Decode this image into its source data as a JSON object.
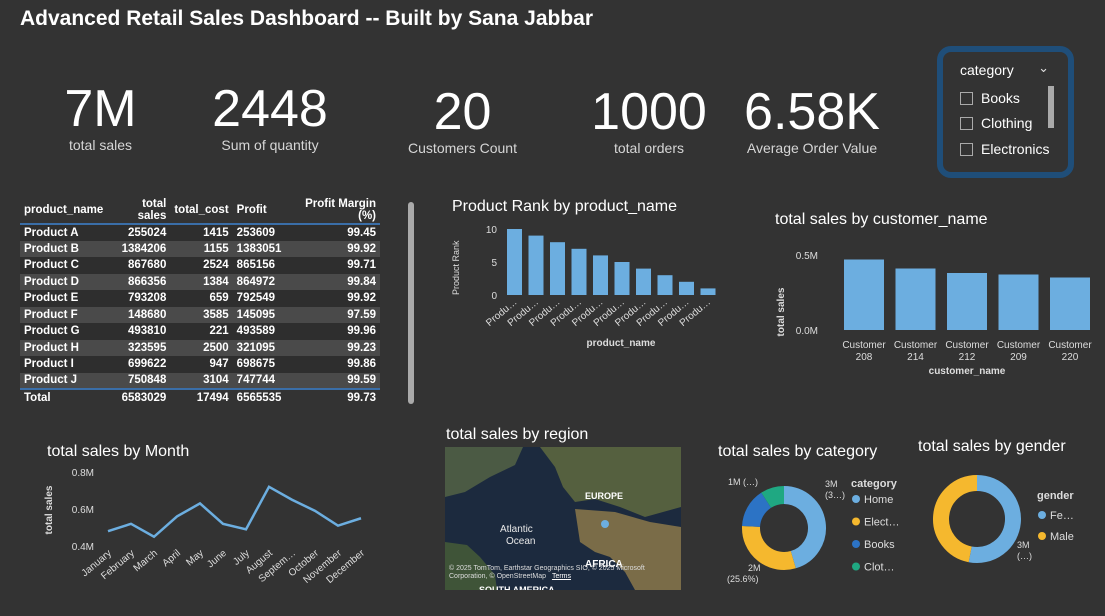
{
  "title": "Advanced Retail Sales Dashboard -- Built by Sana Jabbar",
  "kpis": [
    {
      "value": "7M",
      "label": "total sales"
    },
    {
      "value": "2448",
      "label": "Sum of quantity"
    },
    {
      "value": "20",
      "label": "Customers Count"
    },
    {
      "value": "1000",
      "label": "total orders"
    },
    {
      "value": "6.58K",
      "label": "Average Order Value"
    }
  ],
  "slicer": {
    "header": "category",
    "options": [
      "Books",
      "Clothing",
      "Electronics"
    ]
  },
  "table": {
    "columns": [
      "product_name",
      "total sales",
      "total_cost",
      "Profit",
      "Profit Margin (%)"
    ],
    "rows": [
      [
        "Product A",
        "255024",
        "1415",
        "253609",
        "99.45"
      ],
      [
        "Product B",
        "1384206",
        "1155",
        "1383051",
        "99.92"
      ],
      [
        "Product C",
        "867680",
        "2524",
        "865156",
        "99.71"
      ],
      [
        "Product D",
        "866356",
        "1384",
        "864972",
        "99.84"
      ],
      [
        "Product E",
        "793208",
        "659",
        "792549",
        "99.92"
      ],
      [
        "Product F",
        "148680",
        "3585",
        "145095",
        "97.59"
      ],
      [
        "Product G",
        "493810",
        "221",
        "493589",
        "99.96"
      ],
      [
        "Product H",
        "323595",
        "2500",
        "321095",
        "99.23"
      ],
      [
        "Product I",
        "699622",
        "947",
        "698675",
        "99.86"
      ],
      [
        "Product J",
        "750848",
        "3104",
        "747744",
        "99.59"
      ]
    ],
    "total": [
      "Total",
      "6583029",
      "17494",
      "6565535",
      "99.73"
    ]
  },
  "chart_data": [
    {
      "type": "bar",
      "title": "Product Rank by product_name",
      "xlabel": "product_name",
      "ylabel": "Product Rank",
      "categories": [
        "Produ…",
        "Produ…",
        "Produ…",
        "Produ…",
        "Produ…",
        "Produ…",
        "Produ…",
        "Produ…",
        "Produ…",
        "Produ…"
      ],
      "values": [
        10,
        9,
        8,
        7,
        6,
        5,
        4,
        3,
        2,
        1
      ],
      "yticks": [
        "0",
        "5",
        "10"
      ],
      "ylim": [
        0,
        10
      ],
      "color": "#6caee0"
    },
    {
      "type": "bar",
      "title": "total sales by customer_name",
      "xlabel": "customer_name",
      "ylabel": "total sales",
      "categories": [
        "Customer 208",
        "Customer 214",
        "Customer 212",
        "Customer 209",
        "Customer 220"
      ],
      "values": [
        0.47,
        0.41,
        0.38,
        0.37,
        0.35
      ],
      "yticks": [
        "0.0M",
        "0.5M"
      ],
      "ylim": [
        0,
        0.5
      ],
      "color": "#6caee0"
    },
    {
      "type": "line",
      "title": "total sales by Month",
      "ylabel": "total sales",
      "categories": [
        "January",
        "February",
        "March",
        "April",
        "May",
        "June",
        "July",
        "August",
        "Septem…",
        "October",
        "November",
        "December"
      ],
      "values": [
        0.48,
        0.52,
        0.45,
        0.56,
        0.63,
        0.52,
        0.49,
        0.72,
        0.65,
        0.59,
        0.51,
        0.55
      ],
      "yticks": [
        "0.4M",
        "0.6M",
        "0.8M"
      ],
      "ylim": [
        0.4,
        0.8
      ],
      "color": "#6caee0"
    },
    {
      "type": "pie",
      "title": "total sales by category",
      "legend_title": "category",
      "legend": [
        "Home",
        "Elect…",
        "Books",
        "Clot…"
      ],
      "values": [
        3,
        2,
        1,
        0.6
      ],
      "colors": [
        "#6caee0",
        "#f5b82e",
        "#2c73c5",
        "#1fa882"
      ],
      "labels": [
        "3M\n(3…)",
        "2M\n(25.6%)",
        "1M (…)"
      ]
    },
    {
      "type": "pie",
      "title": "total sales by gender",
      "legend_title": "gender",
      "legend": [
        "Fe…",
        "Male"
      ],
      "values": [
        3.5,
        3.1
      ],
      "colors": [
        "#6caee0",
        "#f5b82e"
      ],
      "labels": [
        "3M\n(…)"
      ]
    }
  ],
  "map": {
    "title": "total sales by region",
    "labels": [
      "EUROPE",
      "Atlantic\nOcean",
      "AFRICA",
      "SOUTH AMERICA"
    ],
    "attribution": "© 2025 TomTom, Earthstar Geographics SIO, © 2025 Microsoft Corporation, © OpenStreetMap",
    "terms": "Terms"
  }
}
